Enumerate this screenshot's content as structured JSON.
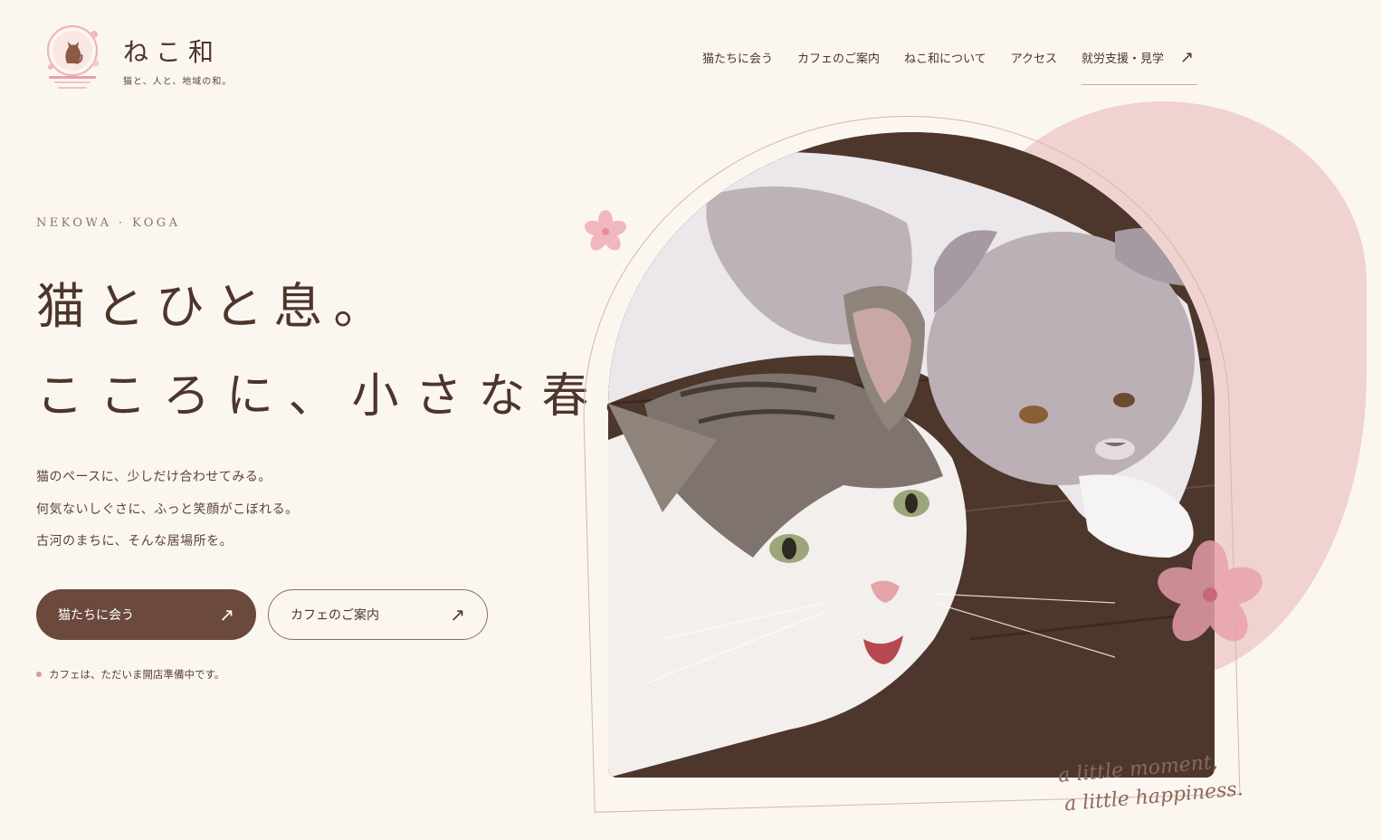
{
  "brand": {
    "name": "ねこ和",
    "tagline": "猫と、人と、地域の和。",
    "logo_icon": "cat-silhouette-cherry-blossom-logo"
  },
  "nav": {
    "items": [
      {
        "label": "猫たちに会う"
      },
      {
        "label": "カフェのご案内"
      },
      {
        "label": "ねこ和について"
      },
      {
        "label": "アクセス"
      }
    ],
    "cta": {
      "label": "就労支援・見学",
      "icon": "arrow-up-right-icon"
    }
  },
  "hero": {
    "eyebrow": "NEKOWA · KOGA",
    "headline_line1": "猫とひと息。",
    "headline_line2": "こころに、小さな春。",
    "lead": [
      "猫のペースに、少しだけ合わせてみる。",
      "何気ないしぐさに、ふっと笑顔がこぼれる。",
      "古河のまちに、そんな居場所を。"
    ],
    "primary_button": {
      "label": "猫たちに会う",
      "icon": "arrow-up-right-icon"
    },
    "secondary_button": {
      "label": "カフェのご案内",
      "icon": "arrow-up-right-icon"
    },
    "notice": "カフェは、ただいま開店準備中です。",
    "script_line1": "a little moment,",
    "script_line2": "a little happiness.",
    "photo": "two-cats-photo",
    "colors": {
      "accent_brown": "#6b4a3d",
      "blush_pink": "#f0d2d1",
      "background": "#fcf6f1",
      "blossom": "#eab5bc"
    }
  }
}
